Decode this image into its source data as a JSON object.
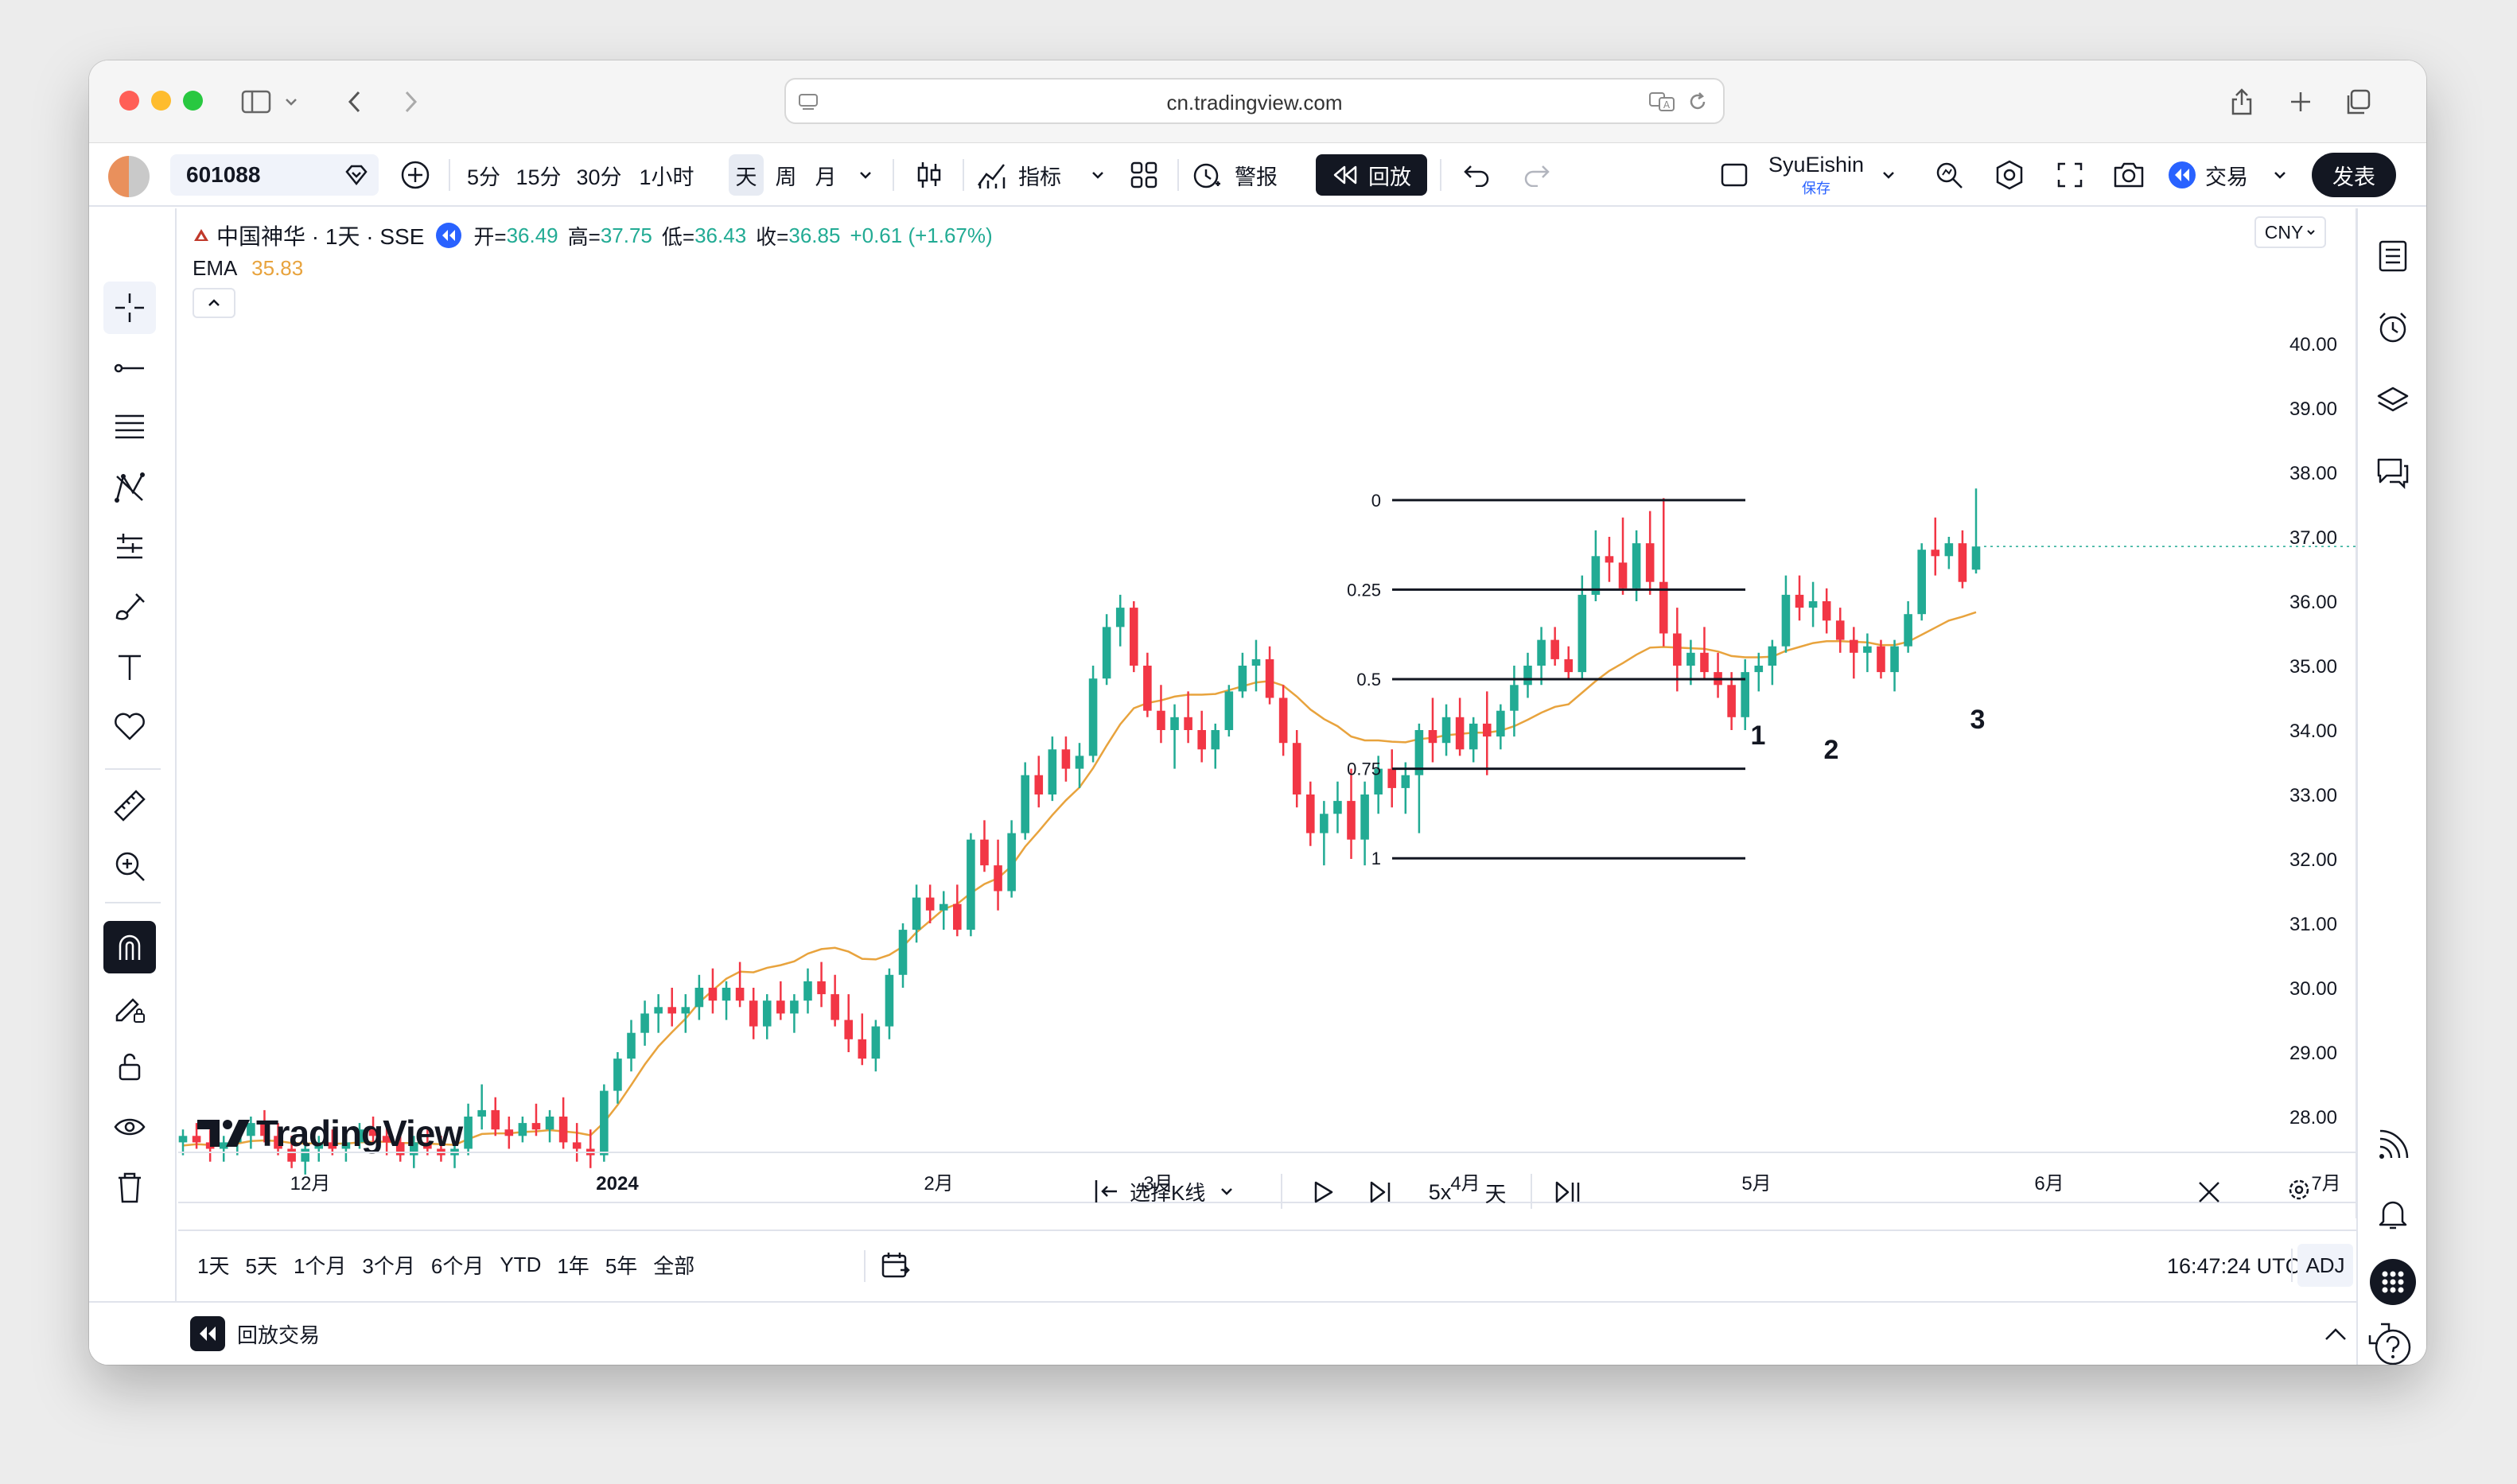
{
  "browser": {
    "url": "cn.tradingview.com"
  },
  "toolbar": {
    "symbol": "601088",
    "intervals": [
      "5分",
      "15分",
      "30分",
      "1小时",
      "天",
      "周",
      "月"
    ],
    "active_interval": "天",
    "indicators_label": "指标",
    "alert_label": "警报",
    "replay_label": "回放",
    "layout_name": "SyuEishin",
    "layout_status": "保存",
    "trade_label": "交易",
    "publish_label": "发表"
  },
  "legend": {
    "name": "中国神华 · 1天 · SSE",
    "open_label": "开=",
    "open": "36.49",
    "high_label": "高=",
    "high": "37.75",
    "low_label": "低=",
    "low": "36.43",
    "close_label": "收=",
    "close": "36.85",
    "change": "+0.61 (+1.67%)",
    "ema_label": "EMA",
    "ema_value": "35.83"
  },
  "currency": "CNY",
  "watermark": "TradingView",
  "chart_data": {
    "type": "candlestick",
    "symbol": "中国神华",
    "price_axis": [
      "40.00",
      "39.00",
      "38.00",
      "37.00",
      "36.00",
      "35.00",
      "34.00",
      "33.00",
      "32.00",
      "31.00",
      "30.00",
      "29.00",
      "28.00"
    ],
    "time_axis": [
      "12月",
      "2024",
      "2月",
      "3月",
      "4月",
      "5月",
      "6月",
      "7月"
    ],
    "last_price": "36.85",
    "fib_levels": [
      {
        "label": "0",
        "value": 37.57
      },
      {
        "label": "0.25",
        "value": 36.18
      },
      {
        "label": "0.5",
        "value": 34.79
      },
      {
        "label": "0.75",
        "value": 33.4
      },
      {
        "label": "1",
        "value": 32.01
      }
    ],
    "annotations": [
      "1",
      "2",
      "3"
    ],
    "candles": [
      [
        27.6,
        27.8,
        27.4,
        27.7
      ],
      [
        27.7,
        27.9,
        27.5,
        27.6
      ],
      [
        27.6,
        27.8,
        27.3,
        27.5
      ],
      [
        27.5,
        27.7,
        27.3,
        27.6
      ],
      [
        27.6,
        27.8,
        27.4,
        27.7
      ],
      [
        27.7,
        28.0,
        27.5,
        27.9
      ],
      [
        27.9,
        28.1,
        27.6,
        27.7
      ],
      [
        27.7,
        27.9,
        27.4,
        27.5
      ],
      [
        27.5,
        27.7,
        27.2,
        27.3
      ],
      [
        27.3,
        27.6,
        27.1,
        27.5
      ],
      [
        27.5,
        27.7,
        27.3,
        27.6
      ],
      [
        27.6,
        27.8,
        27.4,
        27.5
      ],
      [
        27.5,
        27.7,
        27.3,
        27.6
      ],
      [
        27.6,
        27.9,
        27.5,
        27.8
      ],
      [
        27.8,
        28.0,
        27.6,
        27.7
      ],
      [
        27.7,
        27.9,
        27.4,
        27.6
      ],
      [
        27.6,
        27.8,
        27.3,
        27.4
      ],
      [
        27.4,
        27.7,
        27.2,
        27.6
      ],
      [
        27.6,
        27.8,
        27.4,
        27.5
      ],
      [
        27.5,
        27.7,
        27.3,
        27.4
      ],
      [
        27.4,
        27.6,
        27.2,
        27.5
      ],
      [
        27.5,
        28.2,
        27.4,
        28.0
      ],
      [
        28.0,
        28.5,
        27.8,
        28.1
      ],
      [
        28.1,
        28.3,
        27.7,
        27.8
      ],
      [
        27.8,
        28.0,
        27.5,
        27.7
      ],
      [
        27.7,
        28.0,
        27.6,
        27.9
      ],
      [
        27.9,
        28.2,
        27.7,
        27.8
      ],
      [
        27.8,
        28.1,
        27.6,
        28.0
      ],
      [
        28.0,
        28.3,
        27.5,
        27.6
      ],
      [
        27.6,
        27.9,
        27.3,
        27.5
      ],
      [
        27.5,
        27.8,
        27.2,
        27.4
      ],
      [
        27.4,
        28.5,
        27.3,
        28.4
      ],
      [
        28.4,
        29.0,
        28.2,
        28.9
      ],
      [
        28.9,
        29.5,
        28.7,
        29.3
      ],
      [
        29.3,
        29.8,
        29.1,
        29.6
      ],
      [
        29.6,
        29.9,
        29.3,
        29.7
      ],
      [
        29.7,
        30.0,
        29.4,
        29.6
      ],
      [
        29.6,
        29.9,
        29.3,
        29.7
      ],
      [
        29.7,
        30.2,
        29.5,
        30.0
      ],
      [
        30.0,
        30.3,
        29.6,
        29.8
      ],
      [
        29.8,
        30.1,
        29.5,
        30.0
      ],
      [
        30.0,
        30.4,
        29.7,
        29.8
      ],
      [
        29.8,
        30.0,
        29.2,
        29.4
      ],
      [
        29.4,
        29.9,
        29.2,
        29.8
      ],
      [
        29.8,
        30.1,
        29.5,
        29.6
      ],
      [
        29.6,
        29.9,
        29.3,
        29.8
      ],
      [
        29.8,
        30.3,
        29.6,
        30.1
      ],
      [
        30.1,
        30.4,
        29.7,
        29.9
      ],
      [
        29.9,
        30.2,
        29.4,
        29.5
      ],
      [
        29.5,
        29.9,
        29.0,
        29.2
      ],
      [
        29.2,
        29.6,
        28.8,
        28.9
      ],
      [
        28.9,
        29.5,
        28.7,
        29.4
      ],
      [
        29.4,
        30.3,
        29.2,
        30.2
      ],
      [
        30.2,
        31.0,
        30.0,
        30.9
      ],
      [
        30.9,
        31.6,
        30.7,
        31.4
      ],
      [
        31.4,
        31.6,
        31.0,
        31.2
      ],
      [
        31.2,
        31.5,
        30.9,
        31.3
      ],
      [
        31.3,
        31.6,
        30.8,
        30.9
      ],
      [
        30.9,
        32.4,
        30.8,
        32.3
      ],
      [
        32.3,
        32.6,
        31.8,
        31.9
      ],
      [
        31.9,
        32.3,
        31.2,
        31.5
      ],
      [
        31.5,
        32.6,
        31.4,
        32.4
      ],
      [
        32.4,
        33.5,
        32.3,
        33.3
      ],
      [
        33.3,
        33.6,
        32.8,
        33.0
      ],
      [
        33.0,
        33.9,
        32.9,
        33.7
      ],
      [
        33.7,
        33.9,
        33.2,
        33.4
      ],
      [
        33.4,
        33.8,
        33.1,
        33.6
      ],
      [
        33.6,
        35.0,
        33.5,
        34.8
      ],
      [
        34.8,
        35.8,
        34.7,
        35.6
      ],
      [
        35.6,
        36.1,
        35.3,
        35.9
      ],
      [
        35.9,
        36.0,
        34.9,
        35.0
      ],
      [
        35.0,
        35.2,
        34.2,
        34.3
      ],
      [
        34.3,
        34.7,
        33.8,
        34.0
      ],
      [
        34.0,
        34.4,
        33.4,
        34.2
      ],
      [
        34.2,
        34.6,
        33.8,
        34.0
      ],
      [
        34.0,
        34.3,
        33.5,
        33.7
      ],
      [
        33.7,
        34.1,
        33.4,
        34.0
      ],
      [
        34.0,
        34.7,
        33.9,
        34.6
      ],
      [
        34.6,
        35.2,
        34.5,
        35.0
      ],
      [
        35.0,
        35.4,
        34.6,
        35.1
      ],
      [
        35.1,
        35.3,
        34.4,
        34.5
      ],
      [
        34.5,
        34.7,
        33.6,
        33.8
      ],
      [
        33.8,
        34.0,
        32.8,
        33.0
      ],
      [
        33.0,
        33.2,
        32.2,
        32.4
      ],
      [
        32.4,
        32.9,
        31.9,
        32.7
      ],
      [
        32.7,
        33.2,
        32.4,
        32.9
      ],
      [
        32.9,
        33.4,
        32.0,
        32.3
      ],
      [
        32.3,
        33.2,
        31.9,
        33.0
      ],
      [
        33.0,
        33.6,
        32.7,
        33.4
      ],
      [
        33.4,
        33.7,
        32.8,
        33.1
      ],
      [
        33.1,
        33.5,
        32.7,
        33.3
      ],
      [
        33.3,
        34.1,
        32.4,
        34.0
      ],
      [
        34.0,
        34.5,
        33.5,
        33.8
      ],
      [
        33.8,
        34.4,
        33.6,
        34.2
      ],
      [
        34.2,
        34.5,
        33.6,
        33.7
      ],
      [
        33.7,
        34.2,
        33.5,
        34.1
      ],
      [
        34.1,
        34.6,
        33.3,
        33.9
      ],
      [
        33.9,
        34.4,
        33.7,
        34.3
      ],
      [
        34.3,
        35.0,
        33.9,
        34.7
      ],
      [
        34.7,
        35.2,
        34.5,
        35.0
      ],
      [
        35.0,
        35.6,
        34.7,
        35.4
      ],
      [
        35.4,
        35.6,
        35.0,
        35.1
      ],
      [
        35.1,
        35.3,
        34.8,
        34.9
      ],
      [
        34.9,
        36.4,
        34.8,
        36.1
      ],
      [
        36.1,
        37.1,
        36.0,
        36.7
      ],
      [
        36.7,
        37.0,
        36.3,
        36.6
      ],
      [
        36.6,
        37.3,
        36.1,
        36.2
      ],
      [
        36.2,
        37.1,
        36.0,
        36.9
      ],
      [
        36.9,
        37.4,
        36.1,
        36.3
      ],
      [
        36.3,
        37.6,
        35.3,
        35.5
      ],
      [
        35.5,
        35.9,
        34.6,
        35.0
      ],
      [
        35.0,
        35.4,
        34.7,
        35.2
      ],
      [
        35.2,
        35.6,
        34.8,
        34.9
      ],
      [
        34.9,
        35.2,
        34.5,
        34.7
      ],
      [
        34.7,
        34.9,
        34.0,
        34.2
      ],
      [
        34.2,
        35.1,
        34.0,
        34.9
      ],
      [
        34.9,
        35.2,
        34.6,
        35.0
      ],
      [
        35.0,
        35.4,
        34.7,
        35.3
      ],
      [
        35.3,
        36.4,
        35.2,
        36.1
      ],
      [
        36.1,
        36.4,
        35.7,
        35.9
      ],
      [
        35.9,
        36.3,
        35.6,
        36.0
      ],
      [
        36.0,
        36.2,
        35.5,
        35.7
      ],
      [
        35.7,
        35.9,
        35.2,
        35.4
      ],
      [
        35.4,
        35.6,
        34.8,
        35.2
      ],
      [
        35.2,
        35.5,
        34.9,
        35.3
      ],
      [
        35.3,
        35.4,
        34.8,
        34.9
      ],
      [
        34.9,
        35.4,
        34.6,
        35.3
      ],
      [
        35.3,
        36.0,
        35.2,
        35.8
      ],
      [
        35.8,
        36.9,
        35.7,
        36.8
      ],
      [
        36.8,
        37.3,
        36.4,
        36.7
      ],
      [
        36.7,
        37.0,
        36.5,
        36.9
      ],
      [
        36.9,
        37.1,
        36.2,
        36.3
      ],
      [
        36.49,
        37.75,
        36.43,
        36.85
      ]
    ],
    "ema": [
      27.55,
      27.57,
      27.56,
      27.57,
      27.58,
      27.62,
      27.63,
      27.62,
      27.59,
      27.58,
      27.59,
      27.58,
      27.58,
      27.6,
      27.61,
      27.61,
      27.59,
      27.59,
      27.58,
      27.57,
      27.56,
      27.65,
      27.73,
      27.74,
      27.74,
      27.76,
      27.77,
      27.79,
      27.77,
      27.75,
      27.71,
      27.91,
      28.18,
      28.49,
      28.81,
      29.09,
      29.31,
      29.52,
      29.77,
      29.96,
      30.14,
      30.25,
      30.24,
      30.31,
      30.35,
      30.41,
      30.53,
      30.6,
      30.62,
      30.56,
      30.45,
      30.44,
      30.51,
      30.64,
      30.86,
      31.04,
      31.22,
      31.3,
      31.47,
      31.61,
      31.7,
      31.89,
      32.19,
      32.43,
      32.68,
      32.91,
      33.11,
      33.41,
      33.76,
      34.09,
      34.34,
      34.42,
      34.46,
      34.52,
      34.55,
      34.55,
      34.56,
      34.62,
      34.68,
      34.74,
      34.76,
      34.69,
      34.52,
      34.32,
      34.17,
      34.06,
      33.9,
      33.84,
      33.84,
      33.82,
      33.81,
      33.86,
      33.88,
      33.92,
      33.94,
      33.96,
      33.96,
      33.99,
      34.06,
      34.16,
      34.27,
      34.36,
      34.4,
      34.58,
      34.76,
      34.92,
      35.04,
      35.17,
      35.28,
      35.29,
      35.28,
      35.27,
      35.26,
      35.22,
      35.15,
      35.13,
      35.13,
      35.14,
      35.23,
      35.29,
      35.35,
      35.38,
      35.38,
      35.37,
      35.36,
      35.32,
      35.32,
      35.37,
      35.48,
      35.59,
      35.7,
      35.76,
      35.83
    ]
  },
  "replay_panel": {
    "select_bar_label": "选择K线",
    "speed": "5x",
    "interval": "天"
  },
  "ranges": [
    "1天",
    "5天",
    "1个月",
    "3个月",
    "6个月",
    "YTD",
    "1年",
    "5年",
    "全部"
  ],
  "clock": "16:47:24 UTC+8",
  "adj_label": "ADJ",
  "footer": {
    "replay_trading_label": "回放交易"
  },
  "colors": {
    "up": "#22ab94",
    "down": "#f23645",
    "ema": "#e8a33d",
    "accent": "#2962ff"
  }
}
